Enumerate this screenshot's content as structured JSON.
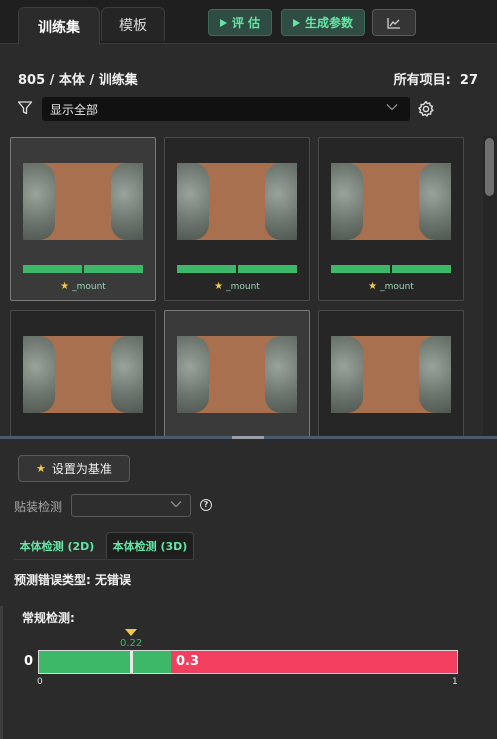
{
  "tabs": [
    {
      "label": "训练集",
      "active": true
    },
    {
      "label": "模板",
      "active": false
    }
  ],
  "toolbar": {
    "evaluate_label": "评 估",
    "generate_label": "生成参数",
    "chart_icon": "line-chart-icon"
  },
  "header": {
    "breadcrumb": "805 / 本体 / 训练集",
    "count_label": "所有项目:",
    "count_value": "27"
  },
  "filter": {
    "selected": "显示全部"
  },
  "gallery": {
    "cards": [
      {
        "caption": "_mount",
        "has_caption": true,
        "selected": true
      },
      {
        "caption": "_mount",
        "has_caption": true,
        "selected": false
      },
      {
        "caption": "_mount",
        "has_caption": true,
        "selected": false
      },
      {
        "caption": "",
        "has_caption": false,
        "selected": false
      },
      {
        "caption": "",
        "has_caption": false,
        "selected": true
      },
      {
        "caption": "",
        "has_caption": false,
        "selected": false
      }
    ]
  },
  "panel": {
    "set_baseline_label": "设置为基准",
    "mount_label": "贴装检测",
    "mount_value": "",
    "subtabs": [
      "本体检测 (2D)",
      "本体检测 (3D)"
    ],
    "error_type": "预测错误类型: 无错误",
    "routine_label": "常规检测:",
    "gauge": {
      "left_label": "0",
      "value_text": "0.22",
      "value": 0.22,
      "threshold_text": "0.3",
      "threshold": 0.3,
      "min_label": "0",
      "max_label": "1"
    }
  },
  "colors": {
    "accent_green": "#63e6a5",
    "pass_green": "#3cb868",
    "fail_red": "#f23f5f",
    "marker_yellow": "#f2c94c"
  }
}
